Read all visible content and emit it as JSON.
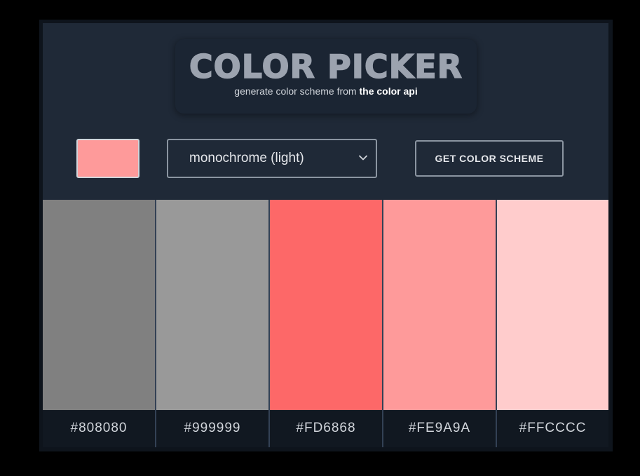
{
  "header": {
    "title": "COLOR PICKER",
    "subtitle_prefix": "generate color scheme from ",
    "subtitle_link": "the color api"
  },
  "controls": {
    "seed_color": "#FE9A9A",
    "mode_value": "monochrome (light)",
    "button_label": "GET COLOR SCHEME"
  },
  "colors": {
    "text_title": "#9CA3AF",
    "panel_bg": "#1F2937"
  },
  "swatches": [
    {
      "hex": "#808080"
    },
    {
      "hex": "#999999"
    },
    {
      "hex": "#FD6868"
    },
    {
      "hex": "#FE9A9A"
    },
    {
      "hex": "#FFCCCC"
    }
  ]
}
